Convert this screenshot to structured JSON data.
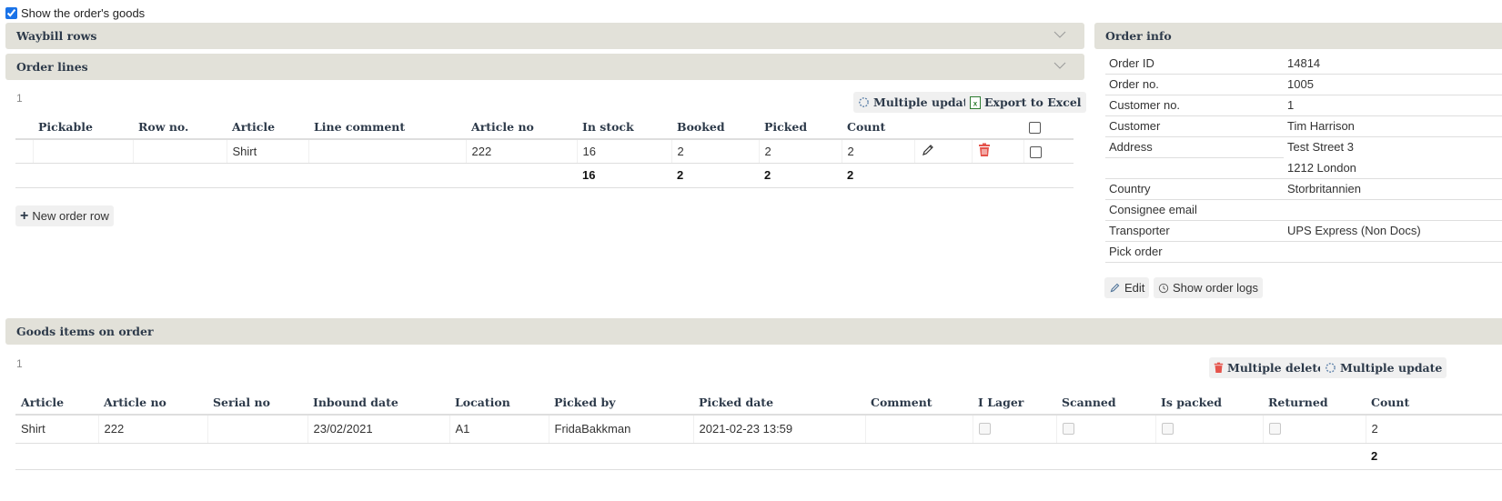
{
  "show_goods": {
    "label": "Show the order's goods",
    "checked": true
  },
  "waybill": {
    "title": "Waybill rows"
  },
  "order_lines": {
    "title": "Order lines",
    "count": "1",
    "multiple_update_label": "Multiple update",
    "export_label": "Export to Excel",
    "columns": [
      "Pickable",
      "Row no.",
      "Article",
      "Line comment",
      "Article no",
      "In stock",
      "Booked",
      "Picked",
      "Count"
    ],
    "rows": [
      {
        "pickable": "",
        "row_no": "",
        "article": "Shirt",
        "line_comment": "",
        "article_no": "222",
        "in_stock": "16",
        "booked": "2",
        "picked": "2",
        "count": "2"
      }
    ],
    "totals": {
      "in_stock": "16",
      "booked": "2",
      "picked": "2",
      "count": "2"
    },
    "new_row_label": "New order row"
  },
  "order_info": {
    "title": "Order info",
    "fields": [
      {
        "key": "Order ID",
        "value": "14814"
      },
      {
        "key": "Order no.",
        "value": "1005"
      },
      {
        "key": "Customer no.",
        "value": "1"
      },
      {
        "key": "Customer",
        "value": "Tim Harrison"
      },
      {
        "key": "Address",
        "value": "Test Street 3"
      },
      {
        "key": "",
        "value": "1212 London"
      },
      {
        "key": "Country",
        "value": "Storbritannien"
      },
      {
        "key": "Consignee email",
        "value": ""
      },
      {
        "key": "Transporter",
        "value": "UPS Express (Non Docs)"
      },
      {
        "key": "Pick order",
        "value": ""
      }
    ],
    "edit_label": "Edit",
    "logs_label": "Show order logs"
  },
  "goods": {
    "title": "Goods items on order",
    "count": "1",
    "multiple_delete_label": "Multiple delete",
    "multiple_update_label": "Multiple update",
    "columns": [
      "Article",
      "Article no",
      "Serial no",
      "Inbound date",
      "Location",
      "Picked by",
      "Picked date",
      "Comment",
      "I Lager",
      "Scanned",
      "Is packed",
      "Returned",
      "Count"
    ],
    "rows": [
      {
        "article": "Shirt",
        "article_no": "222",
        "serial_no": "",
        "inbound_date": "23/02/2021",
        "location": "A1",
        "picked_by": "FridaBakkman",
        "picked_date": "2021-02-23 13:59",
        "comment": "",
        "i_lager": false,
        "scanned": false,
        "is_packed": false,
        "returned": false,
        "count": "2"
      }
    ],
    "totals": {
      "count": "2"
    }
  }
}
